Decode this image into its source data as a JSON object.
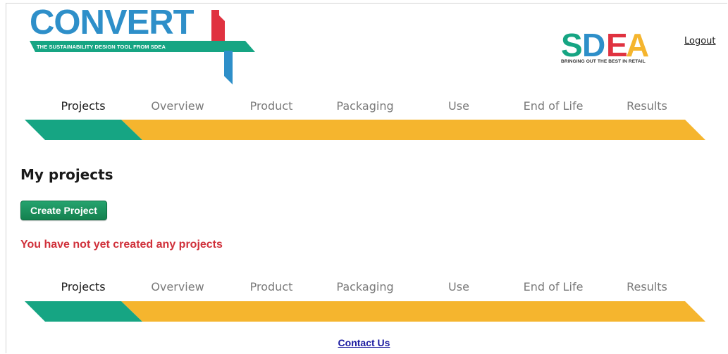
{
  "logo": {
    "title": "CONVERT",
    "tagline": "THE SUSTAINABILITY DESIGN TOOL FROM SDEA",
    "colors": {
      "title": "#2e8fc9",
      "green": "#16a583",
      "yellow": "#f5b52e",
      "red": "#e03240",
      "blue": "#2e8fc9"
    }
  },
  "sdea": {
    "letters": [
      "S",
      "D",
      "E",
      "A"
    ],
    "letter_colors": [
      "#16a583",
      "#2e8fc9",
      "#e03240",
      "#f5b52e"
    ],
    "caption": "BRINGING OUT THE BEST IN RETAIL"
  },
  "header": {
    "logout_label": "Logout"
  },
  "nav": {
    "items": [
      "Projects",
      "Overview",
      "Product",
      "Packaging",
      "Use",
      "End of Life",
      "Results"
    ],
    "active_index": 0,
    "colors": {
      "active": "#16a583",
      "rest": "#f5b52e"
    }
  },
  "main": {
    "heading": "My projects",
    "create_button_label": "Create Project",
    "empty_message": "You have not yet created any projects"
  },
  "footer": {
    "contact_label": "Contact Us"
  }
}
